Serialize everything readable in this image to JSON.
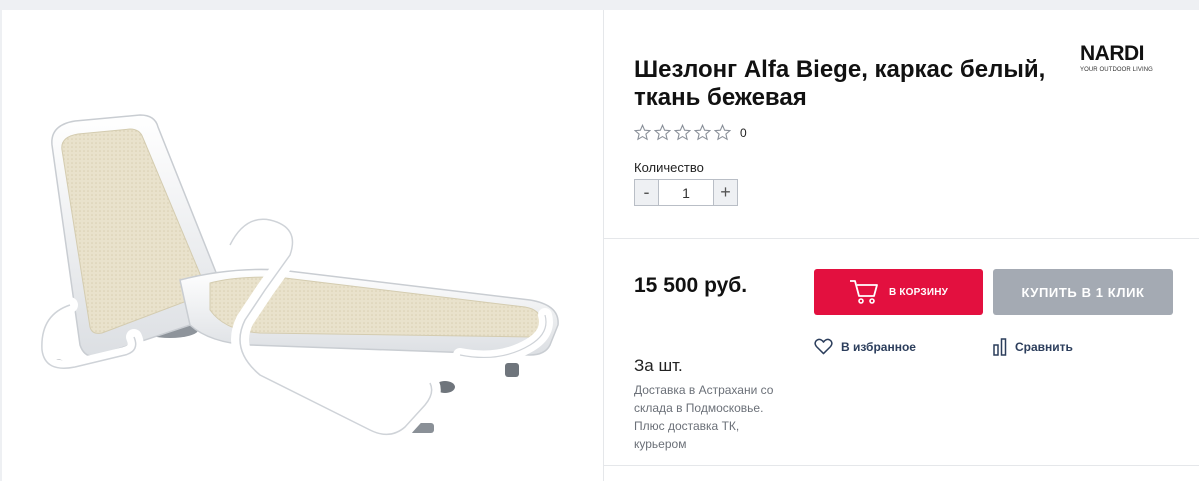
{
  "product": {
    "title": "Шезлонг Alfa Biege, каркас белый, ткань бежевая",
    "image_alt": "Шезлонг Alfa Biege"
  },
  "brand": {
    "name": "NARDI",
    "tagline": "YOUR OUTDOOR LIVING"
  },
  "rating": {
    "stars_filled": 0,
    "stars_total": 5,
    "count": "0"
  },
  "quantity": {
    "label": "Количество",
    "value": "1",
    "minus": "-",
    "plus": "+"
  },
  "price": {
    "value": "15 500 руб.",
    "unit": "За шт."
  },
  "actions": {
    "cart_label": "В КОРЗИНУ",
    "one_click_label": "КУПИТЬ В 1 КЛИК",
    "favorite_label": "В избранное",
    "compare_label": "Сравнить"
  },
  "delivery": {
    "text": "Доставка в Астрахани со склада в Подмосковье. Плюс доставка ТК, курьером"
  },
  "colors": {
    "accent": "#e3103f",
    "secondary_button": "#a4aab3",
    "link": "#2c3e5c"
  },
  "icons": [
    "star-outline-icon",
    "cart-icon",
    "heart-icon",
    "compare-icon"
  ]
}
